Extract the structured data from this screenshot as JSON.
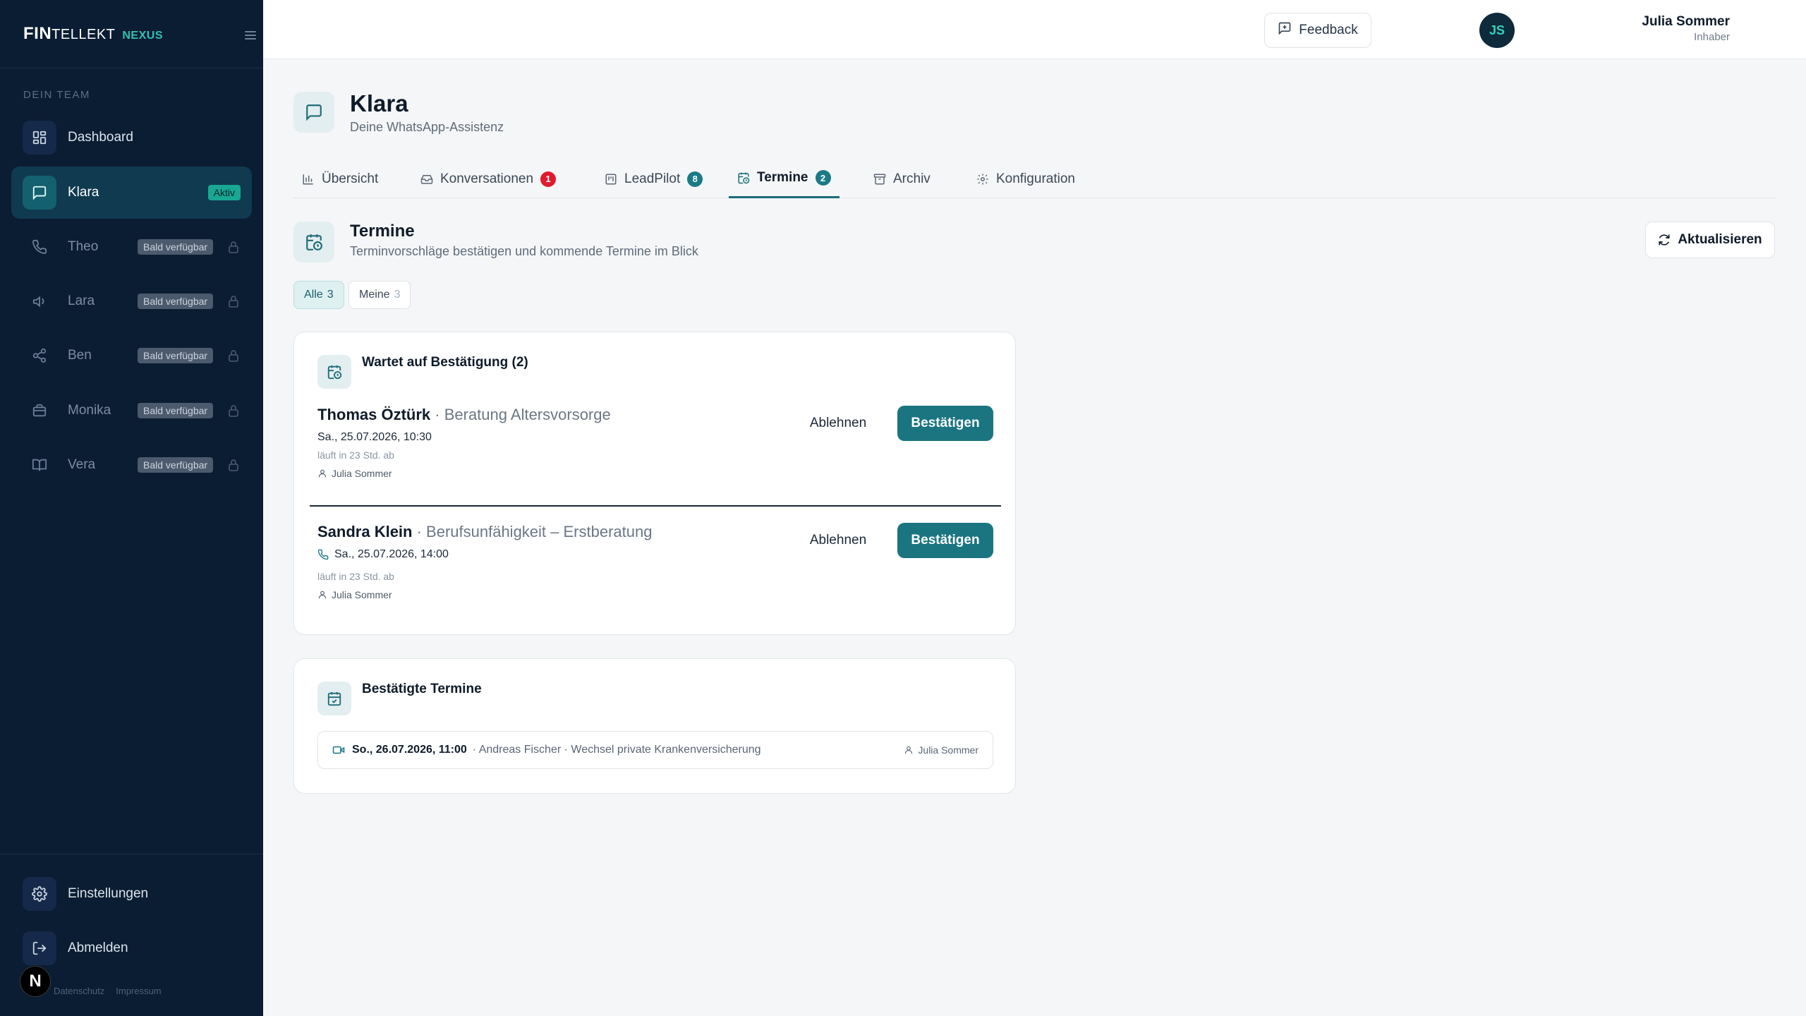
{
  "brand": {
    "fin": "FIN",
    "tellekt": "TELLEKT",
    "nexus": "NEXUS"
  },
  "sidebar": {
    "section_label": "DEIN TEAM",
    "items": [
      {
        "label": "Dashboard",
        "icon": "grid-icon"
      },
      {
        "label": "Klara",
        "icon": "message-square-icon",
        "badge": "Aktiv"
      },
      {
        "label": "Theo",
        "icon": "phone-icon",
        "badge": "Bald verfügbar"
      },
      {
        "label": "Lara",
        "icon": "megaphone-icon",
        "badge": "Bald verfügbar"
      },
      {
        "label": "Ben",
        "icon": "share-icon",
        "badge": "Bald verfügbar"
      },
      {
        "label": "Monika",
        "icon": "briefcase-icon",
        "badge": "Bald verfügbar"
      },
      {
        "label": "Vera",
        "icon": "book-icon",
        "badge": "Bald verfügbar"
      }
    ],
    "settings_label": "Einstellungen",
    "logout_label": "Abmelden",
    "footer": {
      "privacy": "Datenschutz",
      "imprint": "Impressum"
    },
    "n_badge": "N"
  },
  "topbar": {
    "feedback_label": "Feedback",
    "user_name": "Julia Sommer",
    "user_role": "Inhaber",
    "avatar_initials": "JS"
  },
  "page": {
    "title": "Klara",
    "subtitle": "Deine WhatsApp-Assistenz"
  },
  "tabs": [
    {
      "label": "Übersicht"
    },
    {
      "label": "Konversationen",
      "count": "1"
    },
    {
      "label": "LeadPilot",
      "count": "8"
    },
    {
      "label": "Termine",
      "count": "2"
    },
    {
      "label": "Archiv"
    },
    {
      "label": "Konfiguration"
    }
  ],
  "section": {
    "title": "Termine",
    "subtitle": "Terminvorschläge bestätigen und kommende Termine im Blick",
    "refresh_label": "Aktualisieren"
  },
  "filters": [
    {
      "label": "Alle",
      "count": "3"
    },
    {
      "label": "Meine",
      "count": "3"
    }
  ],
  "pending": {
    "title": "Wartet auf Bestätigung (2)",
    "decline_label": "Ablehnen",
    "confirm_label": "Bestätigen",
    "items": [
      {
        "name": "Thomas Öztürk",
        "topic": "· Beratung Altersvorsorge",
        "when": "Sa., 25.07.2026, 10:30",
        "expires": "läuft in 23 Std. ab",
        "owner": "Julia Sommer"
      },
      {
        "name": "Sandra Klein",
        "topic": "· Berufsunfähigkeit – Erstberatung",
        "when": "Sa., 25.07.2026, 14:00",
        "expires": "läuft in 23 Std. ab",
        "owner": "Julia Sommer"
      }
    ]
  },
  "confirmed": {
    "title": "Bestätigte Termine",
    "items": [
      {
        "when": "So., 26.07.2026, 11:00",
        "details": "· Andreas Fischer · Wechsel private Krankenversicherung",
        "owner": "Julia Sommer"
      }
    ]
  },
  "colors": {
    "accent": "#1a7581",
    "sidebar_bg": "#0b1d33",
    "badge_red": "#e01b2d"
  }
}
